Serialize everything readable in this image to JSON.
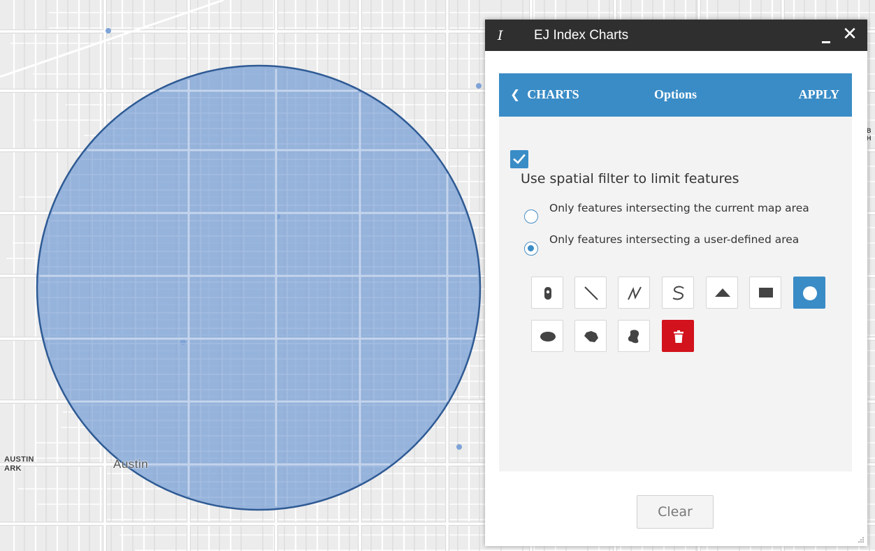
{
  "map": {
    "labels": {
      "austin_park_line1": "AUSTIN",
      "austin_park_line2": "ARK",
      "austin": "Austin",
      "edge_line1": "B",
      "edge_line2": "H"
    },
    "buffer_fill": "#7ea3d6",
    "buffer_stroke": "#2e5a94"
  },
  "panel": {
    "title_icon": "italic-i-icon",
    "title": "EJ Index Charts",
    "close_glyph": "✕",
    "options_bar": {
      "back_label": "CHARTS",
      "title": "Options",
      "apply_label": "APPLY",
      "color": "#3a8cc6"
    },
    "spatial_filter": {
      "checked": true,
      "label": "Use spatial filter to limit features"
    },
    "radio_options": [
      {
        "label": "Only features intersecting the current map area",
        "checked": false
      },
      {
        "label": "Only features intersecting a user-defined area",
        "checked": true
      }
    ],
    "draw_tools": [
      {
        "name": "point-icon",
        "active": false
      },
      {
        "name": "line-icon",
        "active": false
      },
      {
        "name": "polyline-icon",
        "active": false
      },
      {
        "name": "freehand-line-icon",
        "active": false
      },
      {
        "name": "triangle-icon",
        "active": false
      },
      {
        "name": "rectangle-icon",
        "active": false
      },
      {
        "name": "circle-icon",
        "active": true
      },
      {
        "name": "ellipse-icon",
        "active": false
      },
      {
        "name": "polygon-icon",
        "active": false
      },
      {
        "name": "freehand-polygon-icon",
        "active": false
      },
      {
        "name": "trash-icon",
        "active": false
      }
    ],
    "clear_label": "Clear"
  }
}
